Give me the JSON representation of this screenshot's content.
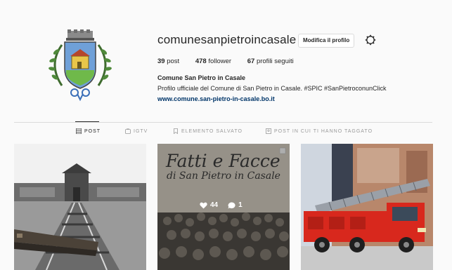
{
  "profile": {
    "username": "comunesanpietroincasale",
    "edit_button": "Modifica il profilo",
    "stats": {
      "posts_count": "39",
      "posts_label": "post",
      "followers_count": "478",
      "followers_label": "follower",
      "following_count": "67",
      "following_label": "profili seguiti"
    },
    "bio": {
      "name": "Comune San Pietro in Casale",
      "text": "Profilo ufficiale del Comune di San Pietro in Casale. #SPIC #SanPietroconunClick",
      "link": "www.comune.san-pietro-in-casale.bo.it"
    }
  },
  "tabs": [
    {
      "label": "POST",
      "icon": "grid-icon",
      "active": true
    },
    {
      "label": "IGTV",
      "icon": "igtv-icon",
      "active": false
    },
    {
      "label": "ELEMENTO SALVATO",
      "icon": "bookmark-icon",
      "active": false
    },
    {
      "label": "POST IN CUI TI HANNO TAGGATO",
      "icon": "tag-icon",
      "active": false
    }
  ],
  "posts": [
    {
      "description": "railway-memorial-photo"
    },
    {
      "title": "Fatti e Facce",
      "subtitle": "di San Pietro in Casale",
      "likes": "44",
      "comments": "1"
    },
    {
      "description": "fire-truck-photo"
    }
  ],
  "colors": {
    "background": "#fafafa",
    "text": "#262626",
    "muted": "#999999",
    "link": "#003569",
    "border": "#dbdbdb",
    "truck_red": "#d8281d"
  }
}
